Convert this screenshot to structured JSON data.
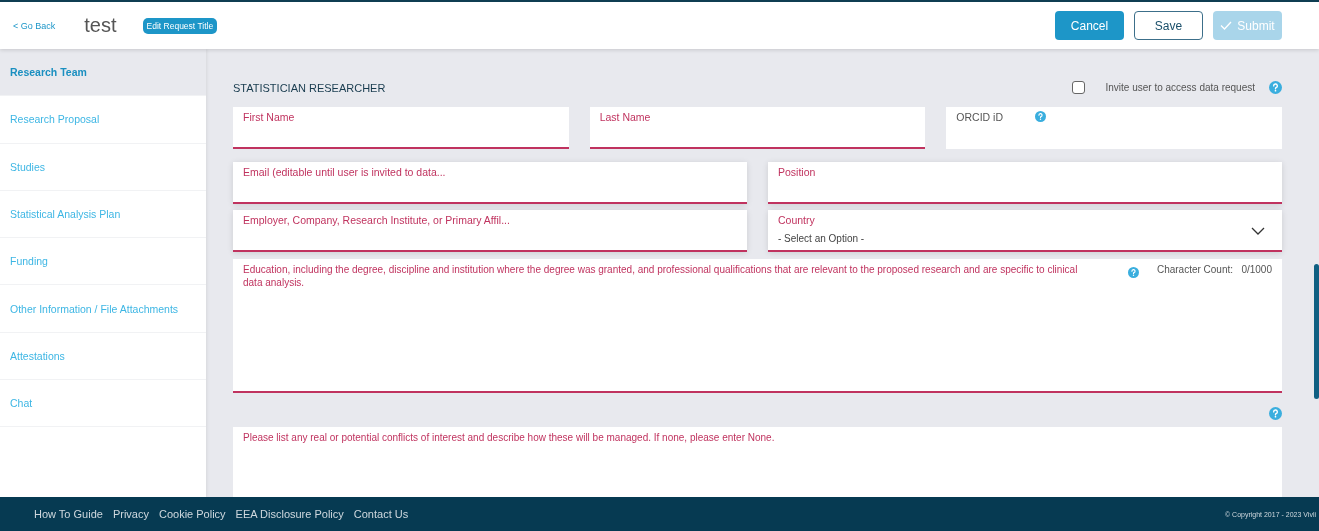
{
  "header": {
    "back_link": "< Go Back",
    "title": "test",
    "edit_title_button": "Edit Request Title",
    "buttons": [
      {
        "kind": "primary",
        "label": "Cancel",
        "disabled": false
      },
      {
        "kind": "outline",
        "label": "Save",
        "disabled": false
      },
      {
        "kind": "submit",
        "label": "Submit",
        "disabled": true
      }
    ]
  },
  "sidebar": {
    "items": [
      {
        "label": "Research Team",
        "selected": true
      },
      {
        "label": "Research Proposal",
        "selected": false
      },
      {
        "label": "Studies",
        "selected": false
      },
      {
        "label": "Statistical Analysis Plan",
        "selected": false
      },
      {
        "label": "Funding",
        "selected": false
      },
      {
        "label": "Other Information / File Attachments",
        "selected": false
      },
      {
        "label": "Attestations",
        "selected": false
      },
      {
        "label": "Chat",
        "selected": false
      }
    ]
  },
  "section": {
    "title": "STATISTICIAN RESEARCHER",
    "invite": {
      "label": "Invite user to access data request",
      "checked": false
    },
    "field_rows": [
      [
        {
          "kind": "text",
          "label": "First Name",
          "required": true
        },
        {
          "kind": "text",
          "label": "Last Name",
          "required": true
        },
        {
          "kind": "text",
          "label": "ORCID iD",
          "required": false,
          "help": true
        }
      ],
      [
        {
          "kind": "text",
          "label": "Email (editable until user is invited to data...",
          "required": true
        },
        {
          "kind": "text",
          "label": "Position",
          "required": true
        }
      ],
      [
        {
          "kind": "text",
          "label": "Employer, Company, Research Institute, or Primary Affil...",
          "required": true
        },
        {
          "kind": "select",
          "label": "Country",
          "required": true,
          "value": "- Select an Option -"
        }
      ]
    ],
    "education": {
      "label": "Education, including the degree, discipline and institution where the degree was granted, and professional qualifications that are relevant to the proposed research and are specific to clinical data analysis.",
      "count_label": "Character Count:",
      "count": "0/1000",
      "required": true
    },
    "conflicts": {
      "label": "Please list any real or potential conflicts of interest and describe how these will be managed. If none, please enter None.",
      "required": true
    }
  },
  "footer": {
    "links": [
      "How To Guide",
      "Privacy",
      "Cookie Policy",
      "EEA Disclosure Policy",
      "Contact Us"
    ],
    "copyright": "© Copyright 2017 - 2023 Vivli"
  }
}
